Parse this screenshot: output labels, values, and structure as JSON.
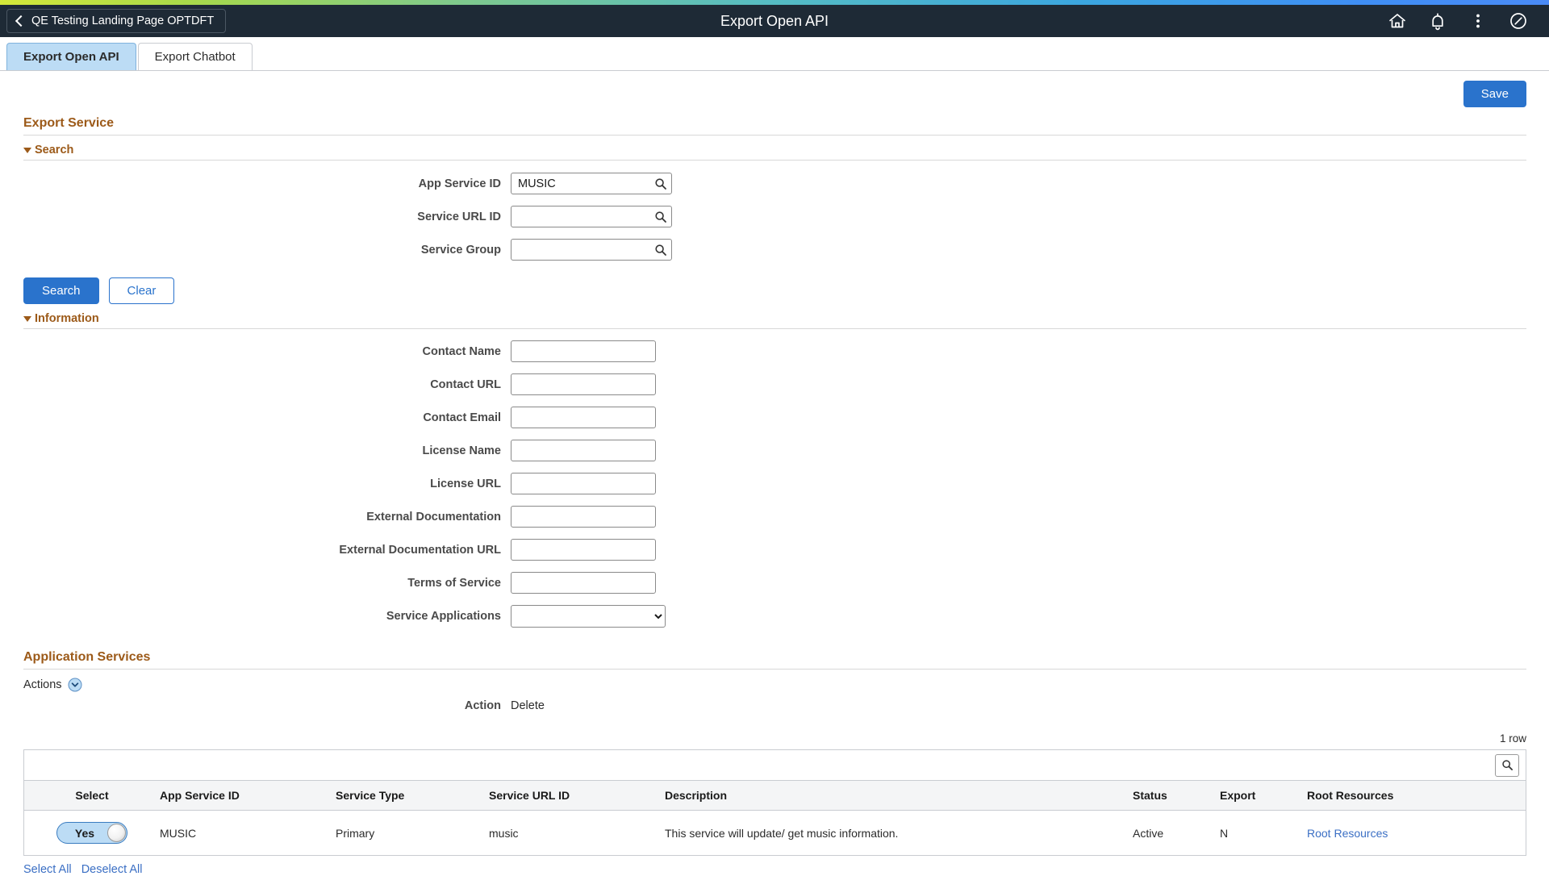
{
  "header": {
    "back_label": "QE Testing Landing Page OPTDFT",
    "title": "Export Open API",
    "icons": [
      "home-icon",
      "notification-bell-icon",
      "actions-menu-icon",
      "navigator-icon"
    ]
  },
  "tabs": [
    {
      "label": "Export Open API",
      "active": true
    },
    {
      "label": "Export Chatbot",
      "active": false
    }
  ],
  "toolbar": {
    "save_label": "Save"
  },
  "export_service": {
    "title": "Export Service",
    "search_section": {
      "label": "Search",
      "fields": [
        {
          "label": "App Service ID",
          "value": "MUSIC",
          "placeholder": ""
        },
        {
          "label": "Service URL ID",
          "value": "",
          "placeholder": ""
        },
        {
          "label": "Service Group",
          "value": "",
          "placeholder": ""
        }
      ],
      "buttons": {
        "search": "Search",
        "clear": "Clear"
      }
    },
    "information_section": {
      "label": "Information",
      "fields": [
        {
          "label": "Contact Name",
          "value": "",
          "placeholder": ""
        },
        {
          "label": "Contact URL",
          "value": "",
          "placeholder": ""
        },
        {
          "label": "Contact Email",
          "value": "",
          "placeholder": ""
        },
        {
          "label": "License Name",
          "value": "",
          "placeholder": ""
        },
        {
          "label": "License URL",
          "value": "",
          "placeholder": ""
        },
        {
          "label": "External Documentation",
          "value": "",
          "placeholder": ""
        },
        {
          "label": "External Documentation URL",
          "value": "",
          "placeholder": ""
        },
        {
          "label": "Terms of Service",
          "value": "",
          "placeholder": ""
        }
      ],
      "dropdown": {
        "label": "Service Applications",
        "value": "",
        "options": [
          ""
        ]
      }
    }
  },
  "application_services": {
    "title": "Application Services",
    "actions_label": "Actions",
    "action_row": {
      "label": "Action",
      "value": "Delete"
    },
    "row_count": "1 row",
    "columns": [
      "Select",
      "App Service ID",
      "Service Type",
      "Service URL ID",
      "Description",
      "Status",
      "Export",
      "Root Resources"
    ],
    "rows": [
      {
        "select": "Yes",
        "app_service_id": "MUSIC",
        "service_type": "Primary",
        "service_url_id": "music",
        "description": "This service will update/ get music information.",
        "status": "Active",
        "export": "N",
        "root_resources": "Root Resources"
      }
    ],
    "bottom_links": [
      "Select All",
      "Deselect All"
    ]
  },
  "colors": {
    "accent_blue": "#2a73cc",
    "section_heading": "#9c5a19",
    "header_bg": "#1e2a36",
    "active_tab": "#bcdcf5",
    "link": "#3b6fc4"
  }
}
